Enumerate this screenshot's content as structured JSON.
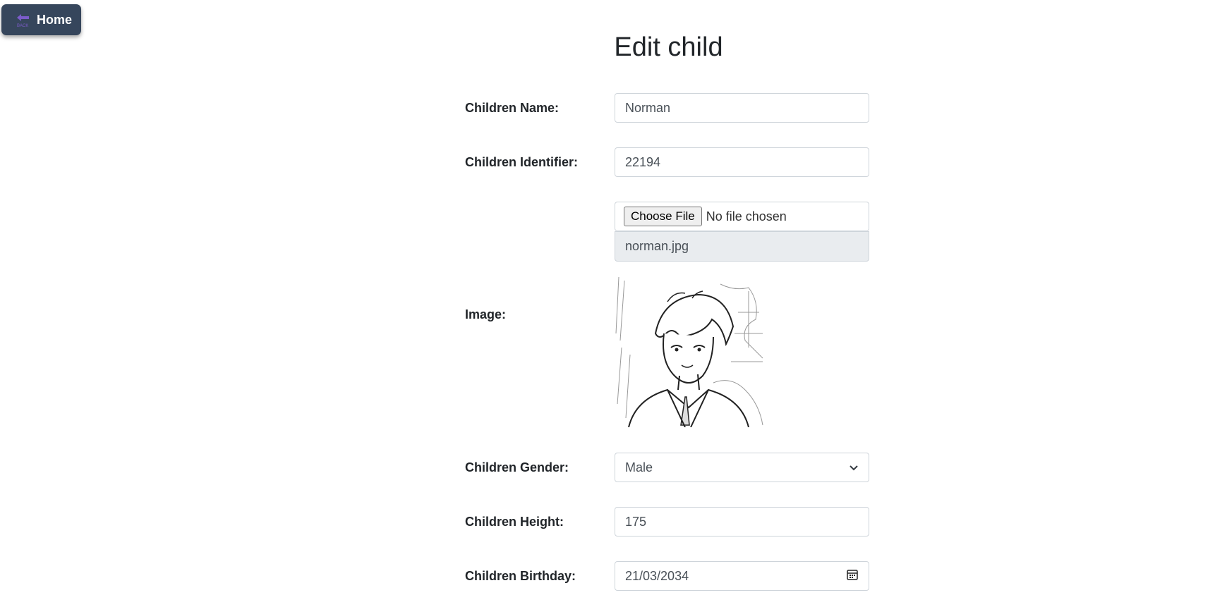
{
  "nav": {
    "home_label": "Home",
    "back_icon_text": "BACK"
  },
  "page": {
    "title": "Edit child"
  },
  "form": {
    "name": {
      "label": "Children Name:",
      "value": "Norman"
    },
    "identifier": {
      "label": "Children Identifier:",
      "value": "22194"
    },
    "image": {
      "label": "Image:",
      "choose_button": "Choose File",
      "file_status": "No file chosen",
      "current_filename": "norman.jpg"
    },
    "gender": {
      "label": "Children Gender:",
      "selected": "Male"
    },
    "height": {
      "label": "Children Height:",
      "value": "175"
    },
    "birthday": {
      "label": "Children Birthday:",
      "value": "21/03/2034"
    }
  }
}
